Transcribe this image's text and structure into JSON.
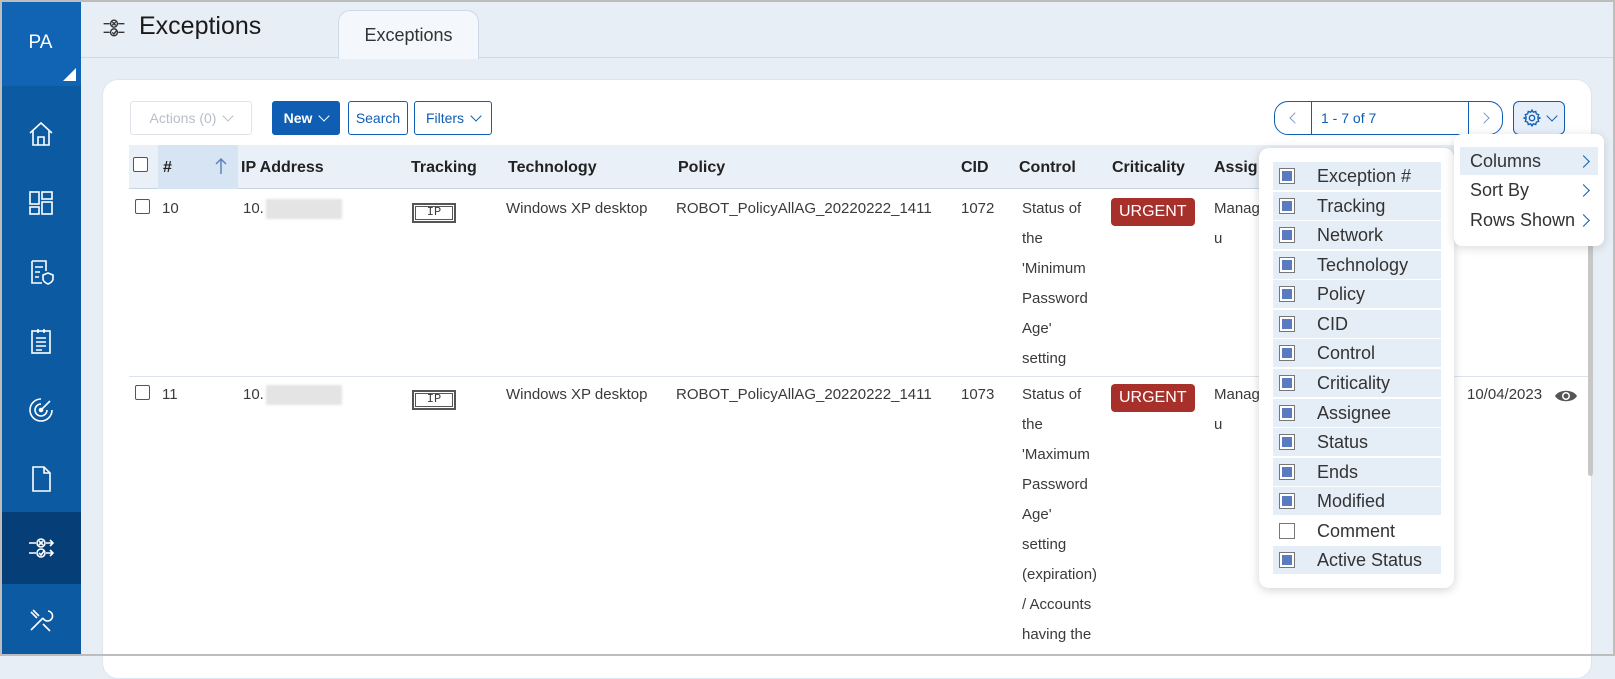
{
  "app": {
    "initials": "PA",
    "page_title": "Exceptions",
    "active_tab": "Exceptions"
  },
  "sidebar": [
    {
      "name": "home-icon"
    },
    {
      "name": "dashboard-icon"
    },
    {
      "name": "policy-icon"
    },
    {
      "name": "report-icon"
    },
    {
      "name": "scan-icon"
    },
    {
      "name": "document-icon"
    },
    {
      "name": "exceptions-icon",
      "active": true
    },
    {
      "name": "tools-icon"
    }
  ],
  "toolbar": {
    "actions_label": "Actions (0)",
    "new_label": "New",
    "search_label": "Search",
    "filters_label": "Filters"
  },
  "pager": {
    "range": "1 - 7 of 7"
  },
  "table": {
    "headers": {
      "num": "#",
      "ip": "IP Address",
      "tracking": "Tracking",
      "technology": "Technology",
      "policy": "Policy",
      "cid": "CID",
      "control": "Control",
      "criticality": "Criticality",
      "assignee": "Assig"
    },
    "rows": [
      {
        "num": "10",
        "ip": "10.",
        "tracking": "IP",
        "technology": "Windows XP desktop",
        "policy": "ROBOT_PolicyAllAG_20220222_1411",
        "cid": "1072",
        "control": [
          "Status of",
          "the",
          "'Minimum",
          "Password",
          "Age'",
          "setting"
        ],
        "criticality": "URGENT",
        "assignee": [
          "Manag",
          "u"
        ]
      },
      {
        "num": "11",
        "ip": "10.",
        "tracking": "IP",
        "technology": "Windows XP desktop",
        "policy": "ROBOT_PolicyAllAG_20220222_1411",
        "cid": "1073",
        "control": [
          "Status of",
          "the",
          "'Maximum",
          "Password",
          "Age'",
          "setting",
          "(expiration)",
          "/ Accounts",
          "having the"
        ],
        "criticality": "URGENT",
        "assignee": [
          "Manag",
          "u"
        ],
        "modified": "10/04/2023"
      }
    ]
  },
  "columns_menu": [
    {
      "label": "Exception #",
      "checked": true
    },
    {
      "label": "Tracking",
      "checked": true
    },
    {
      "label": "Network",
      "checked": true
    },
    {
      "label": "Technology",
      "checked": true
    },
    {
      "label": "Policy",
      "checked": true
    },
    {
      "label": "CID",
      "checked": true
    },
    {
      "label": "Control",
      "checked": true
    },
    {
      "label": "Criticality",
      "checked": true
    },
    {
      "label": "Assignee",
      "checked": true
    },
    {
      "label": "Status",
      "checked": true
    },
    {
      "label": "Ends",
      "checked": true
    },
    {
      "label": "Modified",
      "checked": true
    },
    {
      "label": "Comment",
      "checked": false
    },
    {
      "label": "Active Status",
      "checked": true
    }
  ],
  "settings_menu": [
    {
      "label": "Columns",
      "highlighted": true
    },
    {
      "label": "Sort By"
    },
    {
      "label": "Rows Shown"
    }
  ],
  "colors": {
    "brand": "#0f5eb4",
    "sidebar": "#0b5aa2",
    "urgent": "#a8302b"
  }
}
